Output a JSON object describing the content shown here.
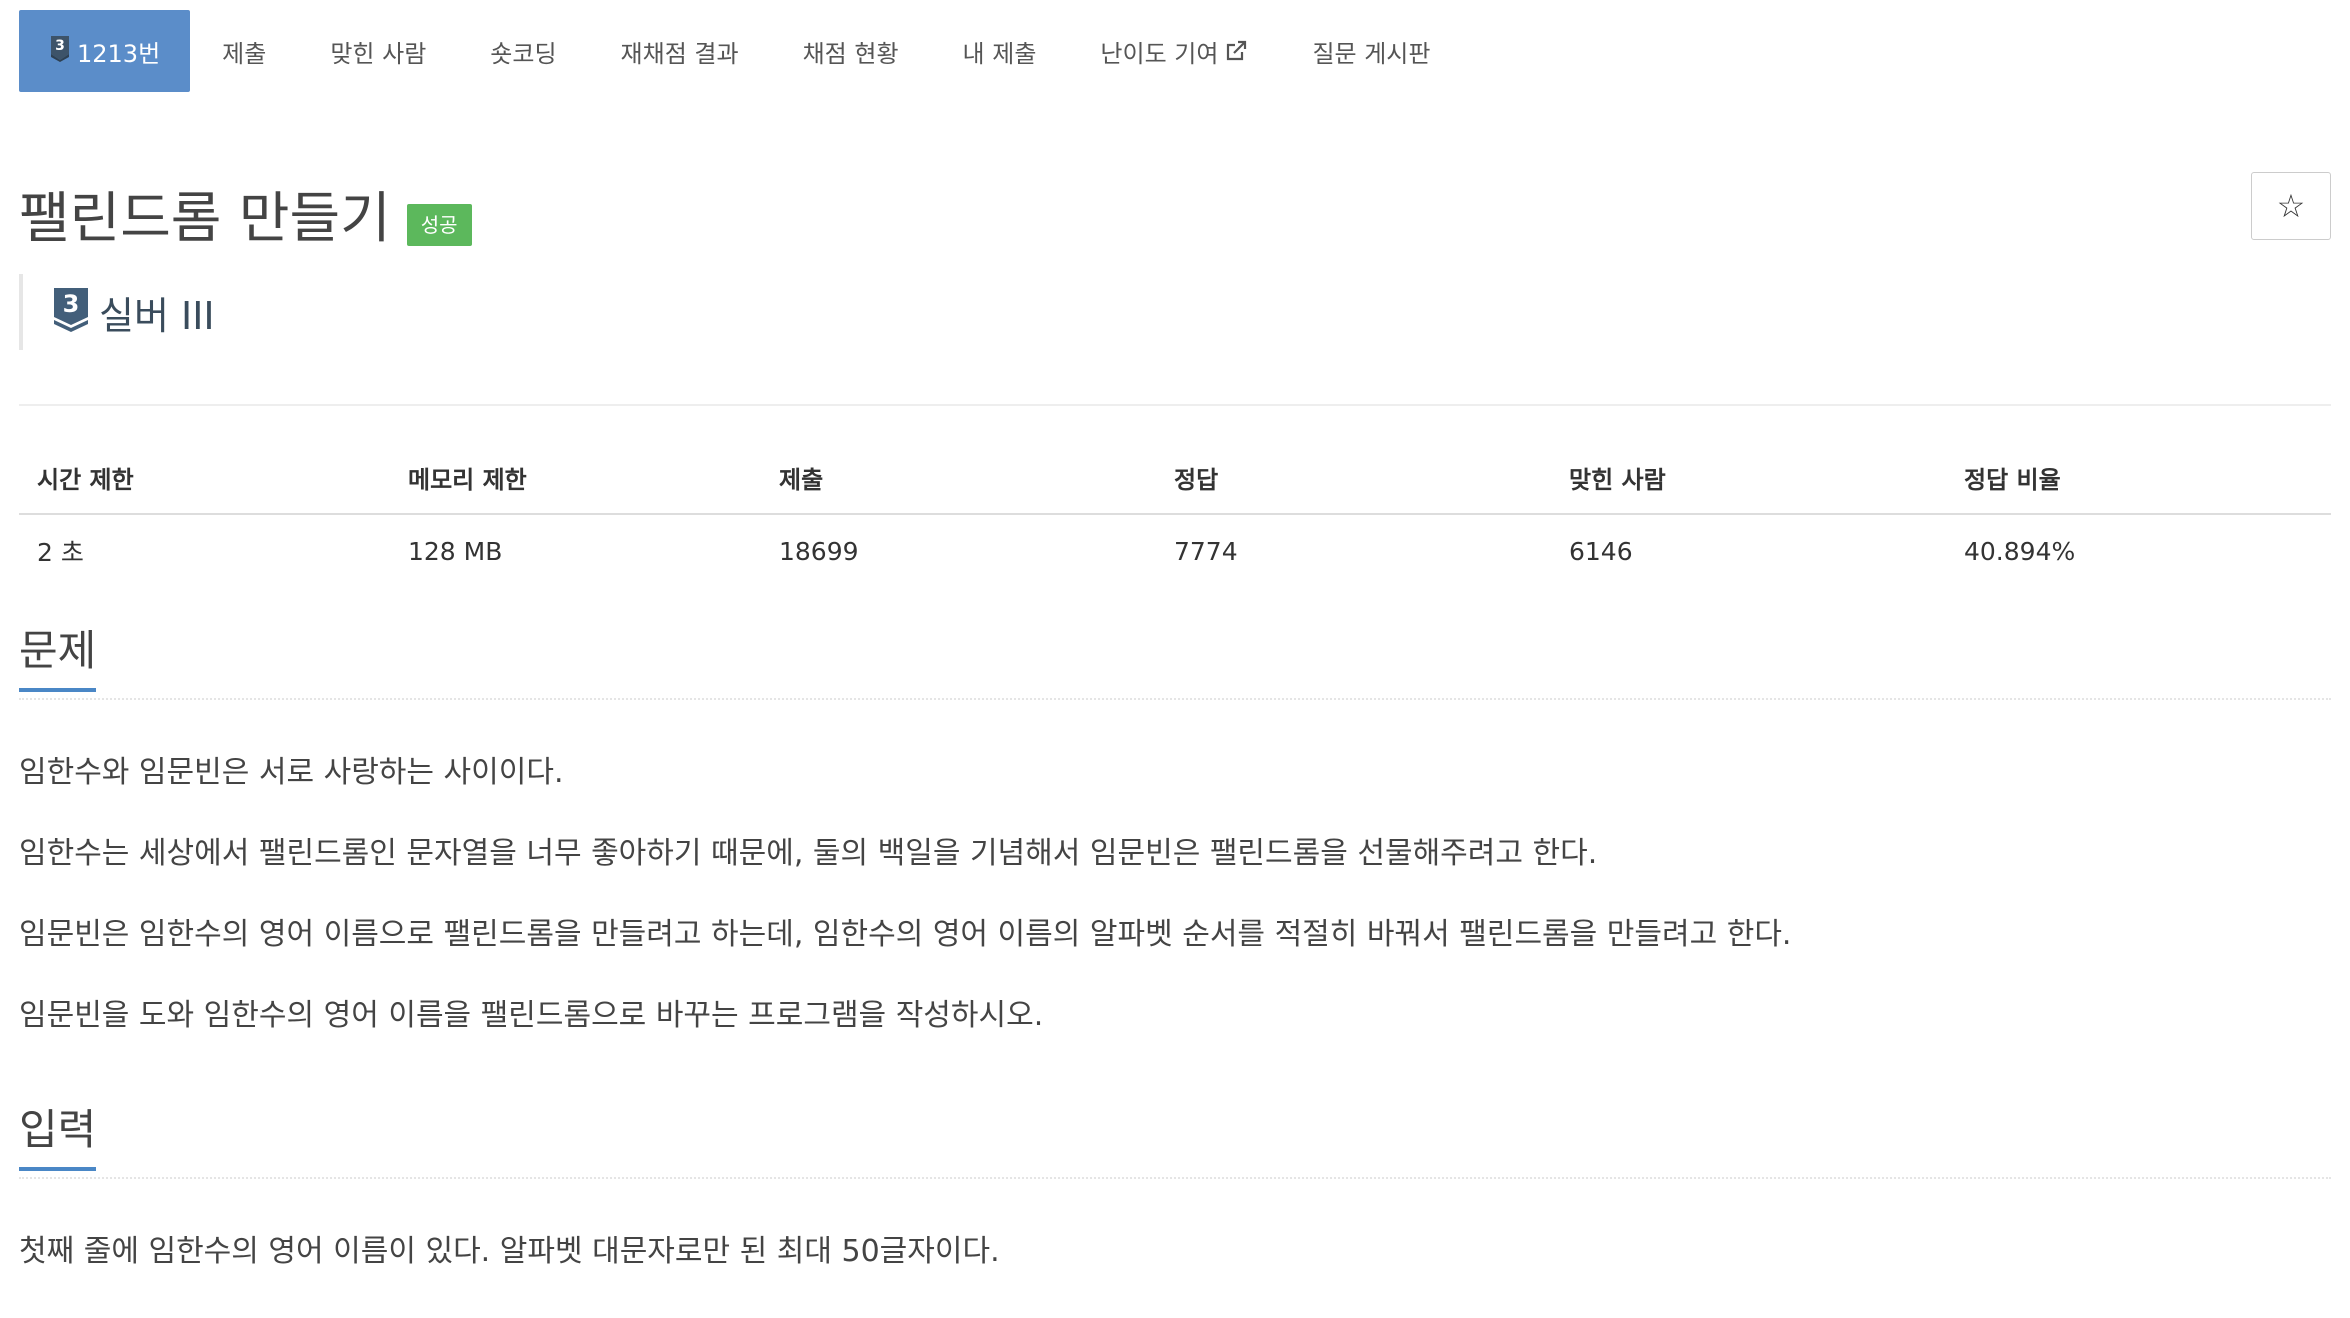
{
  "tabs": [
    {
      "label": "1213번",
      "tier": "3",
      "active": true
    },
    {
      "label": "제출"
    },
    {
      "label": "맞힌 사람"
    },
    {
      "label": "숏코딩"
    },
    {
      "label": "재채점 결과"
    },
    {
      "label": "채점 현황"
    },
    {
      "label": "내 제출"
    },
    {
      "label": "난이도 기여",
      "icon": "external-link-icon"
    },
    {
      "label": "질문 게시판"
    }
  ],
  "problem": {
    "title": "팰린드롬 만들기",
    "result_badge": "성공",
    "tier_number": "3",
    "tier_label": "실버 III",
    "star_icon": "☆"
  },
  "info_table": {
    "headers": [
      "시간 제한",
      "메모리 제한",
      "제출",
      "정답",
      "맞힌 사람",
      "정답 비율"
    ],
    "values": [
      "2 초",
      "128 MB",
      "18699",
      "7774",
      "6146",
      "40.894%"
    ]
  },
  "sections": {
    "problem": {
      "title": "문제",
      "paragraphs": [
        "임한수와 임문빈은 서로 사랑하는 사이이다.",
        "임한수는 세상에서 팰린드롬인 문자열을 너무 좋아하기 때문에, 둘의 백일을 기념해서 임문빈은 팰린드롬을 선물해주려고 한다.",
        "임문빈은 임한수의 영어 이름으로 팰린드롬을 만들려고 하는데, 임한수의 영어 이름의 알파벳 순서를 적절히 바꿔서 팰린드롬을 만들려고 한다.",
        "임문빈을 도와 임한수의 영어 이름을 팰린드롬으로 바꾸는 프로그램을 작성하시오."
      ]
    },
    "input": {
      "title": "입력",
      "paragraphs": [
        "첫째 줄에 임한수의 영어 이름이 있다. 알파벳 대문자로만 된 최대 50글자이다."
      ]
    }
  },
  "colors": {
    "active_tab": "#5b8dc9",
    "success_badge": "#5cb85c",
    "section_underline": "#4a87c6",
    "tier_icon": "#435f7a"
  }
}
